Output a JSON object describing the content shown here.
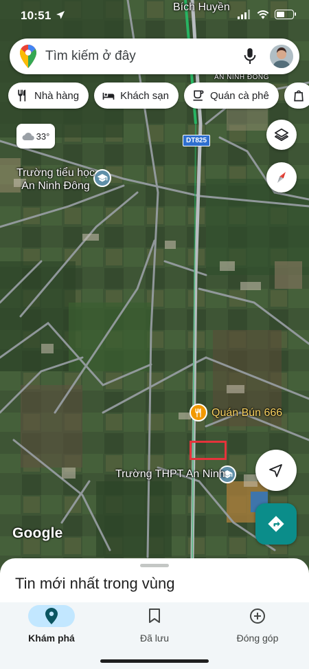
{
  "status_bar": {
    "time": "10:51"
  },
  "search": {
    "placeholder": "Tìm kiếm ở đây"
  },
  "chips": [
    {
      "label": "Nhà hàng",
      "icon": "restaurant-icon"
    },
    {
      "label": "Khách sạn",
      "icon": "hotel-icon"
    },
    {
      "label": "Quán cà phê",
      "icon": "coffee-icon"
    }
  ],
  "weather": {
    "temperature": "33°",
    "icon": "cloud-icon"
  },
  "map": {
    "labels": {
      "top_place": "Bích Huyền",
      "area": "AN NINH ĐÔNG",
      "road": "DT825",
      "school_primary": "Trường tiểu học\nAn Ninh Đông",
      "restaurant": "Quán Bún 666",
      "school_high": "Trường THPT An Ninh"
    },
    "attribution": "Google"
  },
  "sheet": {
    "title": "Tin mới nhất trong vùng"
  },
  "tabs": [
    {
      "label": "Khám phá",
      "icon": "explore-pin-icon",
      "active": true
    },
    {
      "label": "Đã lưu",
      "icon": "bookmark-icon",
      "active": false
    },
    {
      "label": "Đóng góp",
      "icon": "add-circle-icon",
      "active": false
    }
  ],
  "colors": {
    "accent": "#0b8d8a",
    "active_tab_pill": "#c2e7ff",
    "highlight": "#e5333b",
    "restaurant_pin": "#f29900",
    "school_pin": "#5f8fa8"
  }
}
